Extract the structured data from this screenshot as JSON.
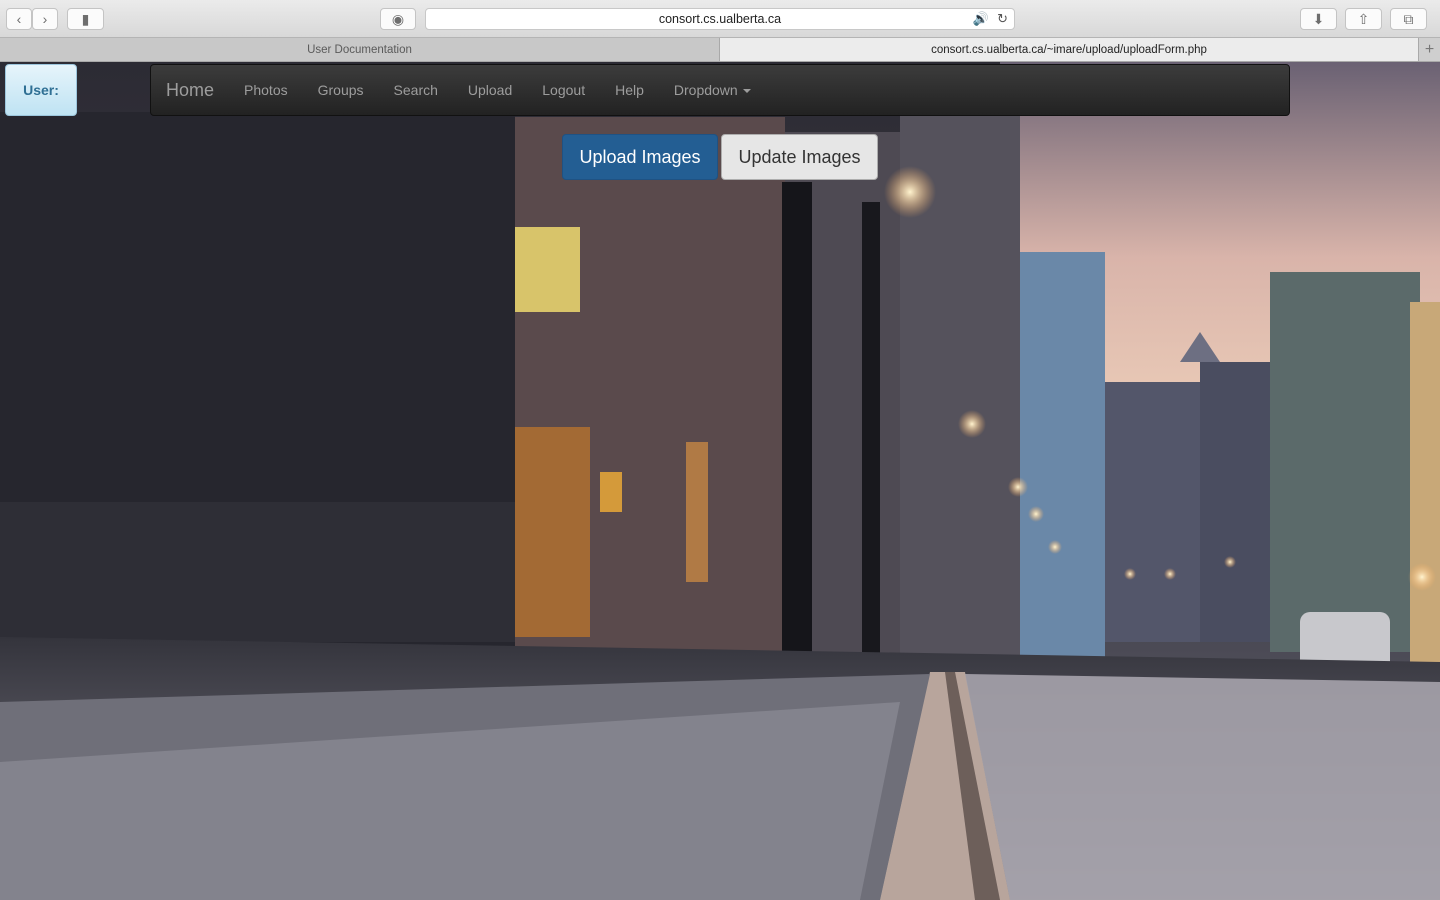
{
  "browser": {
    "address": "consort.cs.ualberta.ca",
    "tabs": [
      {
        "label": "User Documentation"
      },
      {
        "label": "consort.cs.ualberta.ca/~imare/upload/uploadForm.php"
      }
    ]
  },
  "user_badge": {
    "label": "User:"
  },
  "navbar": {
    "brand": "Home",
    "items": [
      {
        "label": "Photos"
      },
      {
        "label": "Groups"
      },
      {
        "label": "Search"
      },
      {
        "label": "Upload"
      },
      {
        "label": "Logout"
      },
      {
        "label": "Help"
      }
    ],
    "dropdown": "Dropdown"
  },
  "actions": {
    "upload": "Upload Images",
    "update": "Update Images"
  },
  "colors": {
    "primary": "#235e93",
    "navbar": "#222222",
    "badge": "#d9eef8"
  }
}
